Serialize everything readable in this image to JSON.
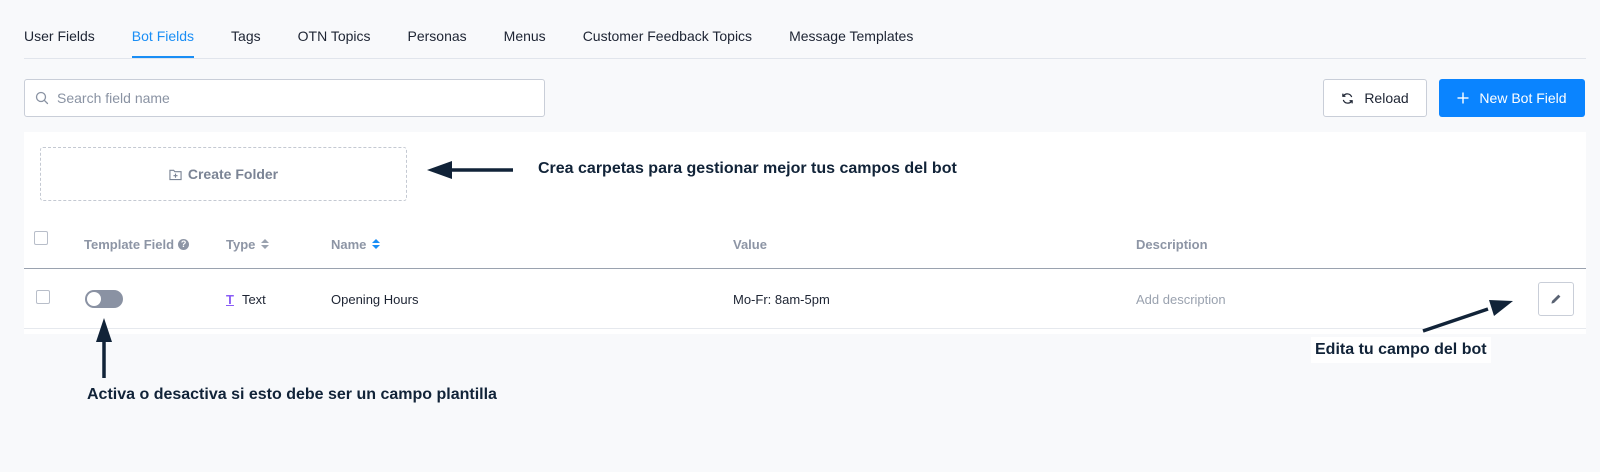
{
  "tabs": [
    {
      "label": "User Fields",
      "active": false
    },
    {
      "label": "Bot Fields",
      "active": true
    },
    {
      "label": "Tags",
      "active": false
    },
    {
      "label": "OTN Topics",
      "active": false
    },
    {
      "label": "Personas",
      "active": false
    },
    {
      "label": "Menus",
      "active": false
    },
    {
      "label": "Customer Feedback Topics",
      "active": false
    },
    {
      "label": "Message Templates",
      "active": false
    }
  ],
  "search": {
    "placeholder": "Search field name",
    "value": ""
  },
  "toolbar": {
    "reload_label": "Reload",
    "new_label": "New Bot Field"
  },
  "folder": {
    "create_label": "Create Folder"
  },
  "table": {
    "columns": {
      "template_field": "Template Field",
      "type": "Type",
      "name": "Name",
      "value": "Value",
      "description": "Description"
    },
    "rows": [
      {
        "template_field_enabled": false,
        "type_icon": "T",
        "type": "Text",
        "name": "Opening Hours",
        "value": "Mo-Fr: 8am-5pm",
        "description_placeholder": "Add description"
      }
    ]
  },
  "annotations": {
    "folder": "Crea carpetas para gestionar mejor tus campos del bot",
    "edit": "Edita tu campo del bot",
    "toggle": "Activa o desactiva si esto debe ser un campo plantilla"
  },
  "colors": {
    "accent": "#0a84ff",
    "active_tab": "#1a8ef5",
    "annotation": "#112338"
  },
  "icons": {
    "search": "search-icon",
    "reload": "reload-icon",
    "new": "plus-icon",
    "folder": "folder-plus-icon",
    "edit": "pencil-icon",
    "help": "question-circle-icon"
  }
}
